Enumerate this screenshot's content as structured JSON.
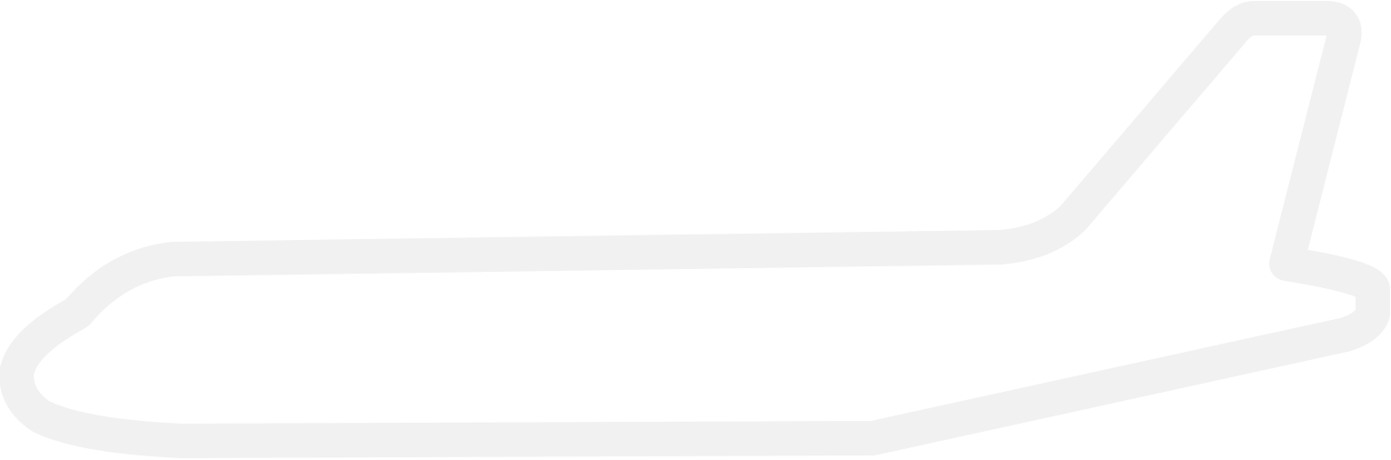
{
  "graphic": {
    "icon": "airplane-outline-icon",
    "stroke_color": "#f1f1f1",
    "fill_color": "#ffffff",
    "background_color": "#ffffff"
  }
}
